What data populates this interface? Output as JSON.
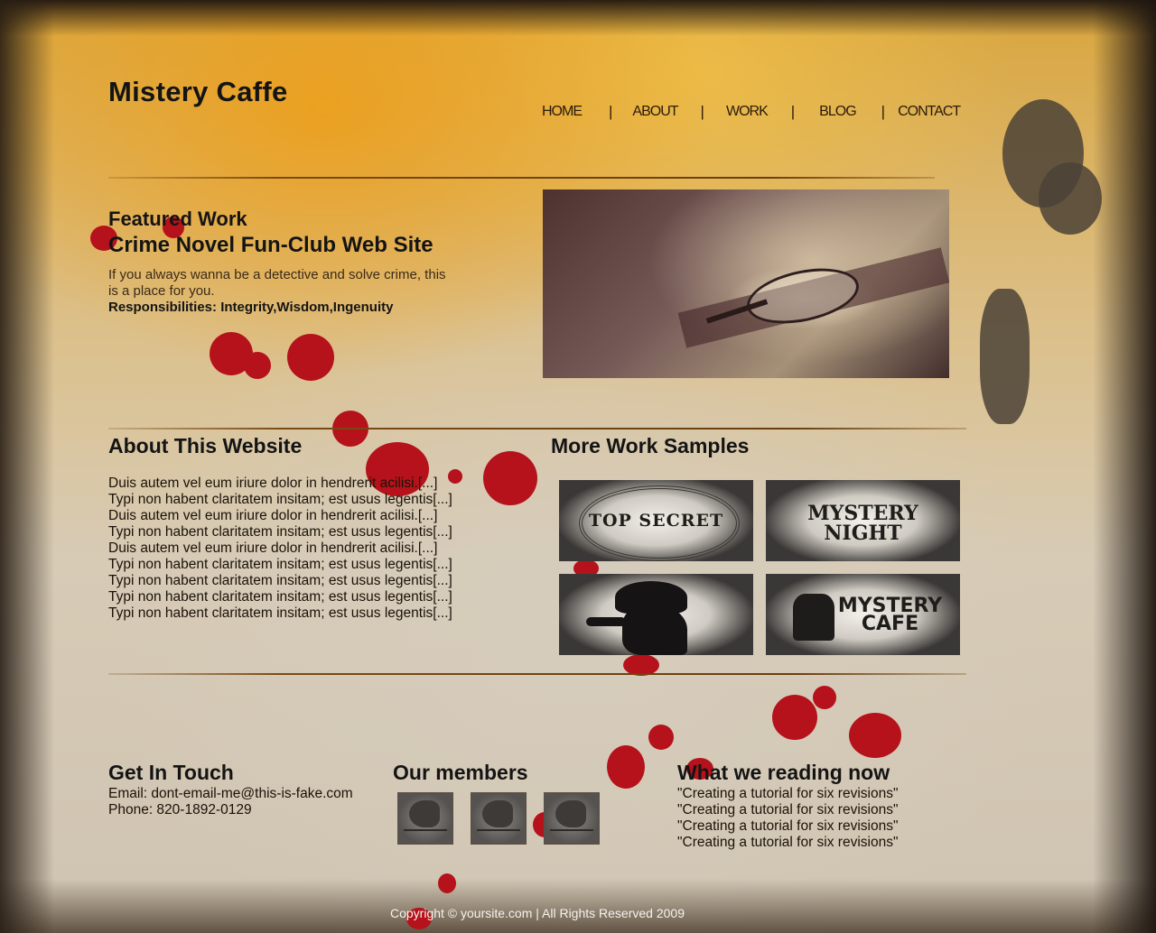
{
  "site": {
    "title": "Mistery Caffe"
  },
  "nav": {
    "items": [
      "HOME",
      "ABOUT",
      "WORK",
      "BLOG",
      "CONTACT"
    ],
    "separator": "|"
  },
  "featured": {
    "heading": "Featured Work",
    "project_title": "Crime Novel Fun-Club Web Site",
    "description": "If you always wanna be a detective and solve crime, this is a place for you.",
    "responsibilities": "Responsibilities: Integrity,Wisdom,Ingenuity"
  },
  "about": {
    "heading": "About This Website",
    "lines": [
      "Duis autem vel eum iriure dolor in hendrerit acilisi.[...]",
      "Typi non habent claritatem insitam; est usus legentis[...]",
      "Duis autem vel eum iriure dolor in hendrerit acilisi.[...]",
      "Typi non habent claritatem insitam; est usus legentis[...]",
      "Duis autem vel eum iriure dolor in hendrerit acilisi.[...]",
      "Typi non habent claritatem insitam; est usus legentis[...]",
      "Typi non habent claritatem insitam; est usus legentis[...]",
      "Typi non habent claritatem insitam; est usus legentis[...]",
      "Typi non habent claritatem insitam; est usus legentis[...]"
    ]
  },
  "samples": {
    "heading": "More Work Samples",
    "items": [
      {
        "text": "TOP SECRET"
      },
      {
        "text": "MYSTERY NIGHT"
      },
      {
        "text": ""
      },
      {
        "text": "MYSTERY CAFE"
      }
    ]
  },
  "contact": {
    "heading": "Get In Touch",
    "email": "Email: dont-email-me@this-is-fake.com",
    "phone": "Phone: 820-1892-0129"
  },
  "members": {
    "heading": "Our members",
    "count": 3
  },
  "reading": {
    "heading": "What we reading now",
    "items": [
      "\"Creating a tutorial for six revisions\"",
      "\"Creating a tutorial for six revisions\"",
      "\"Creating a tutorial for six revisions\"",
      "\"Creating a tutorial for six revisions\""
    ]
  },
  "footer": {
    "copyright": "Copyright © yoursite.com | All Rights Reserved 2009"
  },
  "colors": {
    "accent_rule": "#7a4a12",
    "blood": "#b5121b",
    "paper": "#d7cbb6"
  }
}
